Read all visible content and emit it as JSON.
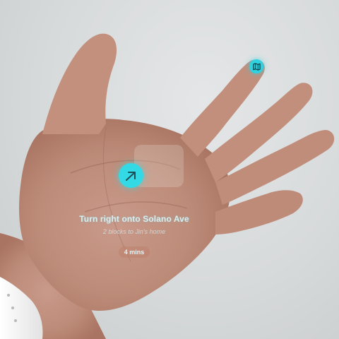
{
  "navigation": {
    "instruction": "Turn right onto Solano Ave",
    "sub_instruction": "2 blocks to Jin's home",
    "eta": "4 mins"
  },
  "controls": {
    "direction_icon": "arrow-right-icon",
    "map_icon": "map-icon"
  },
  "colors": {
    "accent": "#34d9e6",
    "skin": "#c08e7b",
    "background": "#d7dadb",
    "watch_band": "#f2f2f2"
  }
}
